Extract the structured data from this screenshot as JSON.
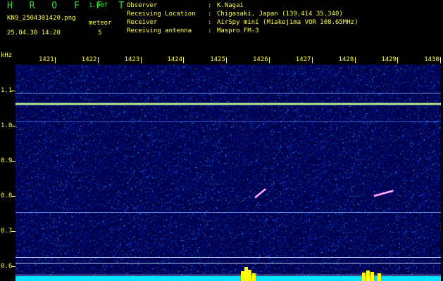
{
  "header": {
    "app_title": "H R O F F T",
    "version": "1.00f",
    "filename": "KN9_2504301420.png",
    "meteor_label": "meteor",
    "datetime": "25.04.30 14:20",
    "meteor_count": "5"
  },
  "info": [
    {
      "key": "Observer",
      "value": "K.Nagai"
    },
    {
      "key": "Receiving Location",
      "value": "Chigasaki, Japan (139.414 35.340)"
    },
    {
      "key": "Receiver",
      "value": "AirSpy mini (Miakejima VOR 108.65MHz)"
    },
    {
      "key": "Receiving antenna",
      "value": "Maspro FM-3"
    }
  ],
  "axis": {
    "y_unit": "kHz",
    "x_ticks": [
      "1421",
      "1422",
      "1423",
      "1424",
      "1425",
      "1426",
      "1427",
      "1428",
      "1429",
      "1430"
    ],
    "y_ticks": [
      "1.1",
      "1.0",
      "0.9",
      "0.8",
      "0.7",
      "0.6"
    ]
  },
  "colors": {
    "label_yellow": "#ffff40",
    "title_green": "#2ee02e",
    "background_blue": "#000046",
    "carrier_line": "#9de89d",
    "baseline_cyan": "#00e0ff",
    "peak_yellow": "#ffff00"
  },
  "echoes": [
    {
      "minute": 1425.67,
      "y_start_khz": 0.795,
      "minute_end": 1425.92,
      "y_end_khz": 0.82
    },
    {
      "minute": 1428.45,
      "y_start_khz": 0.8,
      "minute_end": 1428.9,
      "y_end_khz": 0.815
    }
  ]
}
